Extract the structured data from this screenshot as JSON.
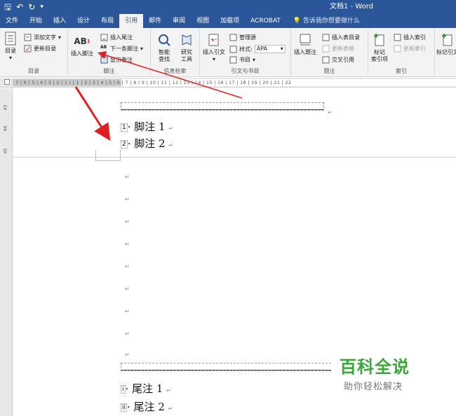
{
  "titlebar": {
    "save_glyph": "🖫",
    "undo_glyph": "↶",
    "redo_glyph": "↻",
    "more_glyph": "▾",
    "doc_title": "文档1 - Word"
  },
  "tabs": [
    "文件",
    "开始",
    "插入",
    "设计",
    "布局",
    "引用",
    "邮件",
    "审阅",
    "视图",
    "加载项",
    "ACROBAT"
  ],
  "active_tab": "引用",
  "tell_me": "告诉我你想要做什么",
  "ribbon": {
    "toc": {
      "toc_btn": "目录",
      "add_text": "添加文字",
      "update_toc": "更新目录",
      "label": "目录"
    },
    "footnotes": {
      "insert_footnote": "插入脚注",
      "insert_endnote": "插入尾注",
      "next_footnote": "下一条脚注",
      "show_notes": "显示备注",
      "label": "脚注",
      "ab_glyph": "AB",
      "sup_glyph": "1"
    },
    "research": {
      "smart_lookup_1": "智能",
      "smart_lookup_2": "查找",
      "researcher_1": "研究",
      "researcher_2": "工具",
      "label": "信息检索"
    },
    "citations": {
      "insert_citation": "插入引文",
      "manage_sources": "管理源",
      "style_label": "样式:",
      "style_value": "APA",
      "bibliography": "书目",
      "label": "引文与书目"
    },
    "captions": {
      "insert_caption": "插入题注",
      "insert_tof": "插入表目录",
      "update_table": "更新表格",
      "cross_ref": "交叉引用",
      "label": "题注"
    },
    "index": {
      "mark_entry_1": "标记",
      "mark_entry_2": "索引项",
      "insert_index": "插入索引",
      "update_index": "更新索引",
      "label": "索引"
    },
    "toa": {
      "mark_citation": "标记引文"
    }
  },
  "ruler": {
    "text": "7 | 6 | 5 | 4 | 3 | 2 | 1 |    | 1 | 2 | 3 | 4 | 5 | 6 | 7 | 8 | 9 | 10 | 11 | 12 | 13 | 14 | 15 | 16 | 17 | 18 | 19 | 20 | 21 | 22"
  },
  "vruler": [
    "43",
    "44",
    "45"
  ],
  "document": {
    "footnotes": [
      {
        "ref": "1",
        "text": "· 脚注 1",
        "mark": "↵"
      },
      {
        "ref": "2",
        "text": "· 脚注 2",
        "mark": "↵"
      }
    ],
    "para_mark": "↵",
    "endnotes": [
      {
        "ref": "i",
        "text": "· 尾注 1",
        "mark": "↵"
      },
      {
        "ref": "ii",
        "text": "· 尾注 2",
        "mark": "↵"
      }
    ]
  },
  "watermark": {
    "title": "百科全说",
    "subtitle": "助你轻松解决"
  },
  "colors": {
    "word_blue": "#2b579a",
    "arrow_red": "#e02020",
    "watermark_green": "#3aa63a"
  }
}
